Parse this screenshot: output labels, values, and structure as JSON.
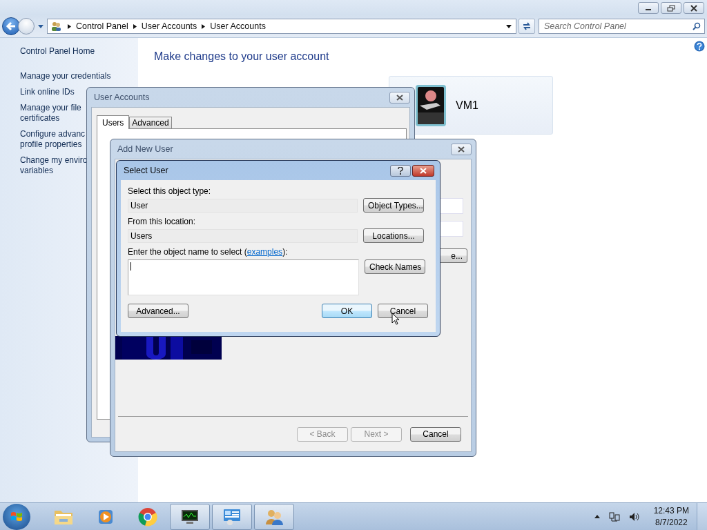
{
  "explorer": {
    "breadcrumb": [
      "Control Panel",
      "User Accounts",
      "User Accounts"
    ],
    "search": {
      "placeholder": "Search Control Panel"
    },
    "sidebar": {
      "items": [
        {
          "lines": [
            "Control Panel Home"
          ]
        },
        {
          "lines": [
            "Manage your credentials"
          ]
        },
        {
          "lines": [
            "Link online IDs"
          ]
        },
        {
          "lines": [
            "Manage your file",
            "certificates"
          ]
        },
        {
          "lines": [
            "Configure advanc",
            "profile properties"
          ]
        },
        {
          "lines": [
            "Change my enviro",
            "variables"
          ]
        }
      ]
    },
    "heading": "Make changes to your user account",
    "account": {
      "name": "VM1"
    }
  },
  "user_accounts_dialog": {
    "title": "User Accounts",
    "tabs": [
      {
        "label": "Users",
        "selected": true
      },
      {
        "label": "Advanced",
        "selected": false
      }
    ]
  },
  "add_user_dialog": {
    "title": "Add New User",
    "partial_button": "e...",
    "buttons": [
      {
        "label": "< Back",
        "disabled": true
      },
      {
        "label": "Next >",
        "disabled": true
      },
      {
        "label": "Cancel",
        "disabled": false
      }
    ]
  },
  "select_user_dialog": {
    "title": "Select User",
    "rows": [
      {
        "label": "Select this object type:",
        "value": "User",
        "button": "Object Types..."
      },
      {
        "label": "From this location:",
        "value": "Users",
        "button": "Locations..."
      }
    ],
    "name_entry": {
      "label_before": "Enter the object name to select (",
      "link": "examples",
      "label_after": "):",
      "button": "Check Names"
    },
    "advanced_button": "Advanced...",
    "ok_button": "OK",
    "cancel_button": "Cancel"
  },
  "taskbar": {
    "items": [
      {
        "kind": "folder",
        "running": false
      },
      {
        "kind": "media",
        "running": false
      },
      {
        "kind": "browser",
        "running": false
      },
      {
        "kind": "monitor",
        "running": true
      },
      {
        "kind": "control-panel",
        "running": true
      },
      {
        "kind": "users",
        "running": true
      }
    ],
    "clock": {
      "time": "12:43 PM",
      "date": "8/7/2022"
    }
  }
}
